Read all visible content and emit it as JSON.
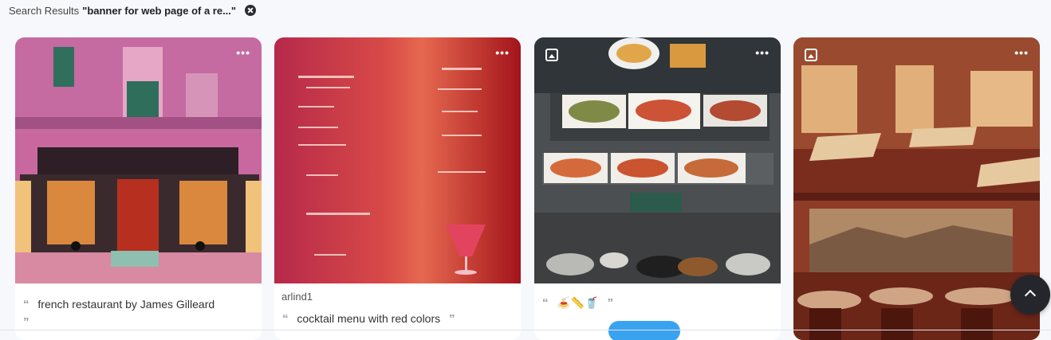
{
  "search": {
    "prefix": "Search Results",
    "query": "\"banner for web page of a re...\""
  },
  "cards": [
    {
      "caption": "french restaurant by James Gilleard",
      "author": "",
      "more": "•••"
    },
    {
      "caption": "cocktail menu with red colors",
      "author": "arlind1",
      "more": "•••"
    },
    {
      "caption": "🍝📏🥤",
      "author": "",
      "more": "•••"
    },
    {
      "caption": "",
      "author": "",
      "more": "•••"
    }
  ],
  "icons": {
    "clear": "close-circle-icon",
    "scroll_top": "chevron-up-icon",
    "image_type": "image-icon",
    "quote": "quote-icon"
  },
  "colors": {
    "accent": "#3aa3f0",
    "dark": "#24262b"
  }
}
